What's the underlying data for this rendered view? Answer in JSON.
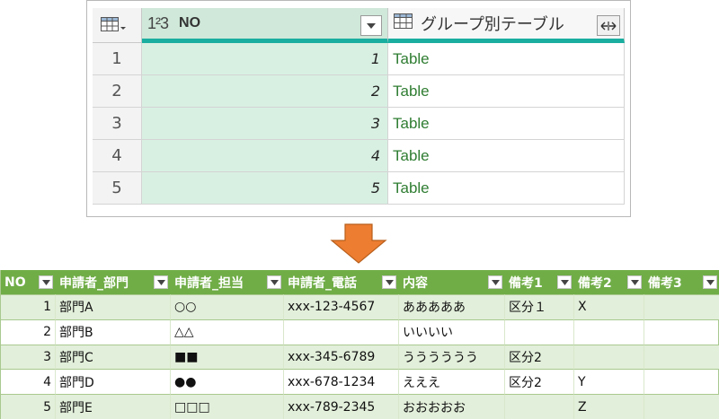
{
  "power_query": {
    "header": {
      "table_menu_icon": "table-menu-icon",
      "type_label": "1²3",
      "no_column": "NO",
      "group_column": "グループ別テーブル"
    },
    "rows": [
      {
        "row_num": "1",
        "no": "1",
        "value": "Table"
      },
      {
        "row_num": "2",
        "no": "2",
        "value": "Table"
      },
      {
        "row_num": "3",
        "no": "3",
        "value": "Table"
      },
      {
        "row_num": "4",
        "no": "4",
        "value": "Table"
      },
      {
        "row_num": "5",
        "no": "5",
        "value": "Table"
      }
    ],
    "colors": {
      "selected_column": "#cfe8d9",
      "accent": "#1aaea0",
      "table_text": "#2f7d32"
    }
  },
  "arrow": {
    "icon": "down-arrow-icon",
    "color": "#ed7d31"
  },
  "excel_table": {
    "headers": [
      "NO",
      "申請者_部門",
      "申請者_担当",
      "申請者_電話",
      "内容",
      "備考1",
      "備考2",
      "備考3"
    ],
    "rows": [
      [
        "1",
        "部門A",
        "○○",
        "xxx-123-4567",
        "あああああ",
        "区分１",
        "X",
        ""
      ],
      [
        "2",
        "部門B",
        "△△",
        "",
        "いいいい",
        "",
        "",
        ""
      ],
      [
        "3",
        "部門C",
        "■■",
        "xxx-345-6789",
        "うううううう",
        "区分2",
        "",
        ""
      ],
      [
        "4",
        "部門D",
        "●●",
        "xxx-678-1234",
        "えええ",
        "区分2",
        "Y",
        ""
      ],
      [
        "5",
        "部門E",
        "□□□",
        "xxx-789-2345",
        "おおおおお",
        "",
        "Z",
        ""
      ]
    ],
    "colors": {
      "header": "#70ad47",
      "band": "#e2efda"
    }
  }
}
